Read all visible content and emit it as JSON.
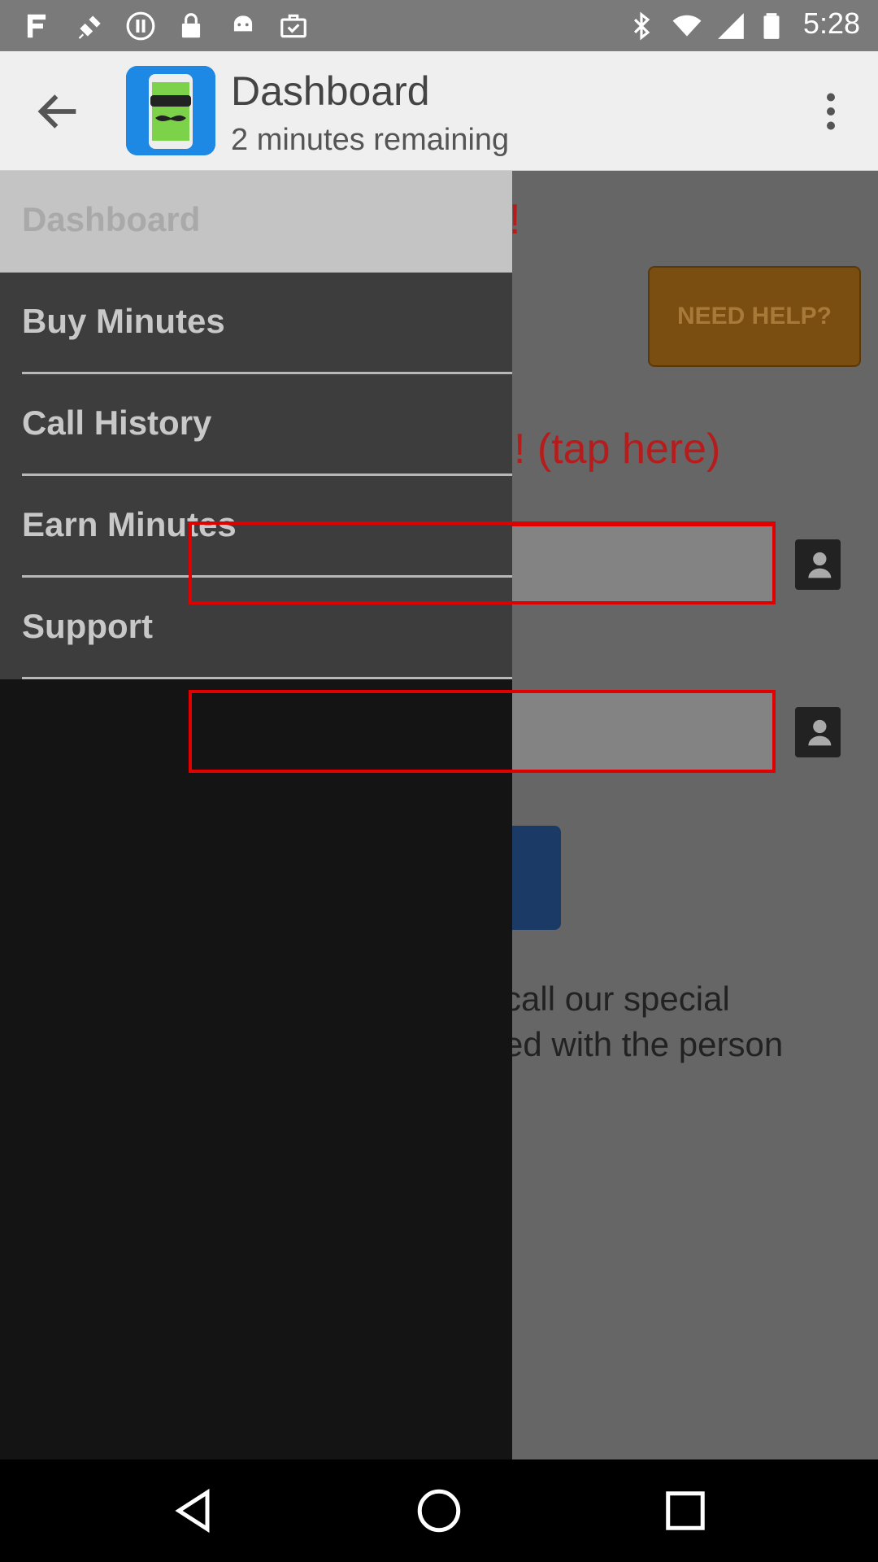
{
  "status_bar": {
    "time": "5:28",
    "left_icons": [
      "fake-gps-icon",
      "satellite-icon",
      "pause-icon",
      "lock-icon",
      "android-icon",
      "briefcase-check-icon"
    ],
    "right_icons": [
      "bluetooth-icon",
      "wifi-icon",
      "signal-icon",
      "battery-icon"
    ]
  },
  "app_bar": {
    "title": "Dashboard",
    "subtitle": "2 minutes remaining",
    "logo_icon": "spy-phone-logo",
    "back_icon": "arrow-back-icon",
    "menu_icon": "more-vert-icon"
  },
  "drawer": {
    "items": [
      {
        "label": "Dashboard",
        "active": true
      },
      {
        "label": "Buy Minutes",
        "active": false
      },
      {
        "label": "Call History",
        "active": false
      },
      {
        "label": "Earn Minutes",
        "active": false
      },
      {
        "label": "Support",
        "active": false
      }
    ]
  },
  "background_content": {
    "heading_fragment": "s!",
    "need_help_label": "NEED HELP?",
    "tap_here_fragment": "! (tap here)",
    "info_line1": "call our special",
    "info_line2": "ed with the person"
  },
  "colors": {
    "highlight_box": "#e00000",
    "red_text": "#b71c1c",
    "need_help_bg": "#7a4d10",
    "call_button": "#1b3a66"
  },
  "nav_bar": {
    "icons": [
      "back-triangle-icon",
      "home-circle-icon",
      "recents-square-icon"
    ]
  }
}
